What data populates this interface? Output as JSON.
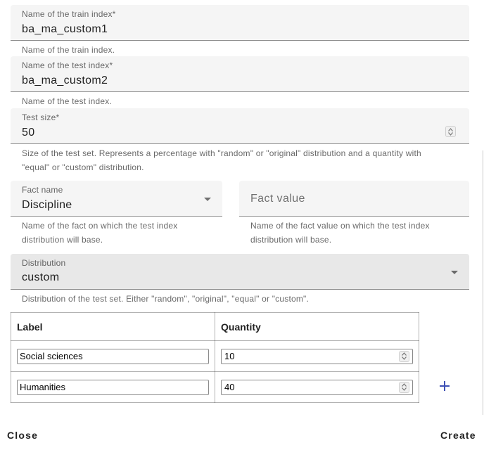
{
  "train_index": {
    "label": "Name of the train index*",
    "value": "ba_ma_custom1",
    "hint": "Name of the train index."
  },
  "test_index": {
    "label": "Name of the test index*",
    "value": "ba_ma_custom2",
    "hint": "Name of the test index."
  },
  "test_size": {
    "label": "Test size*",
    "value": "50",
    "hint_line1": "Size of the test set. Represents a percentage with \"random\" or \"original\" distribution and a quantity with",
    "hint_line2": "\"equal\" or \"custom\" distribution."
  },
  "fact_name": {
    "label": "Fact name",
    "value": "Discipline",
    "hint_line1": "Name of the fact on which the test index",
    "hint_line2": "distribution will base."
  },
  "fact_value": {
    "placeholder": "Fact value",
    "hint_line1": "Name of the fact value on which the test index",
    "hint_line2": "distribution will base."
  },
  "distribution": {
    "label": "Distribution",
    "value": "custom",
    "hint": "Distribution of the test set. Either \"random\", \"original\", \"equal\" or \"custom\"."
  },
  "table": {
    "headers": {
      "label": "Label",
      "quantity": "Quantity"
    },
    "rows": [
      {
        "label": "Social sciences",
        "quantity": "10"
      },
      {
        "label": "Humanities",
        "quantity": "40"
      }
    ]
  },
  "actions": {
    "close": "Close",
    "create": "Create"
  },
  "colors": {
    "accent": "#3f51b5",
    "field_bg": "#f5f5f5"
  }
}
